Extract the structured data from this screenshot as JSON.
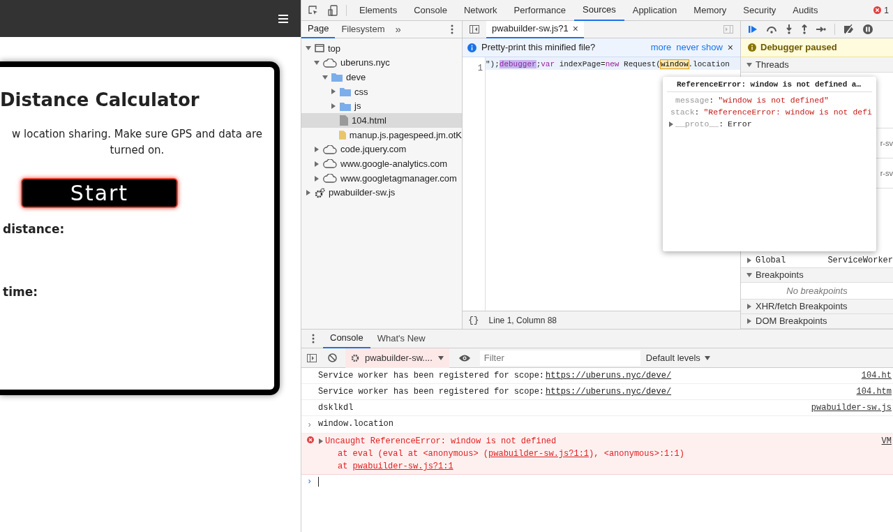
{
  "page": {
    "title": "Distance Calculator",
    "message": "w location sharing. Make sure GPS and data are turned on.",
    "start_button": "Start",
    "labels": [
      "distance:",
      "time:"
    ]
  },
  "devtools": {
    "tabs": [
      {
        "label": "Elements",
        "selected": false
      },
      {
        "label": "Console",
        "selected": false
      },
      {
        "label": "Network",
        "selected": false
      },
      {
        "label": "Performance",
        "selected": false
      },
      {
        "label": "Sources",
        "selected": true
      },
      {
        "label": "Application",
        "selected": false
      },
      {
        "label": "Memory",
        "selected": false
      },
      {
        "label": "Security",
        "selected": false
      },
      {
        "label": "Audits",
        "selected": false
      }
    ],
    "error_count": "1",
    "navigator": {
      "tabs": [
        {
          "label": "Page",
          "selected": true
        },
        {
          "label": "Filesystem",
          "selected": false
        }
      ],
      "more": "»",
      "tree": [
        {
          "label": "top",
          "kind": "frame",
          "expanded": true,
          "selected": false,
          "children": [
            {
              "label": "uberuns.nyc",
              "kind": "domain",
              "expanded": true,
              "selected": false,
              "children": [
                {
                  "label": "deve",
                  "kind": "folder",
                  "expanded": true,
                  "selected": false,
                  "children": [
                    {
                      "label": "css",
                      "kind": "folder",
                      "expanded": false,
                      "selected": false
                    },
                    {
                      "label": "js",
                      "kind": "folder",
                      "expanded": false,
                      "selected": false
                    },
                    {
                      "label": "104.html",
                      "kind": "file",
                      "selected": true
                    },
                    {
                      "label": "manup.js.pagespeed.jm.otK",
                      "kind": "script",
                      "selected": false
                    }
                  ]
                }
              ]
            },
            {
              "label": "code.jquery.com",
              "kind": "domain",
              "expanded": false,
              "selected": false
            },
            {
              "label": "www.google-analytics.com",
              "kind": "domain",
              "expanded": false,
              "selected": false
            },
            {
              "label": "www.googletagmanager.com",
              "kind": "domain",
              "expanded": false,
              "selected": false
            }
          ]
        },
        {
          "label": "pwabuilder-sw.js",
          "kind": "worker",
          "expanded": false,
          "selected": false
        }
      ]
    },
    "editor": {
      "tab": "pwabuilder-sw.js?1",
      "tab_close": "×",
      "infobar": {
        "text": "Pretty-print this minified file?",
        "links": [
          "more",
          "never show"
        ],
        "close": "×"
      },
      "line_number": "1",
      "code": [
        {
          "text": "\");",
          "kind": "plain"
        },
        {
          "text": "debugger",
          "kind": "paused"
        },
        {
          "text": ";",
          "kind": "plain"
        },
        {
          "text": "var",
          "kind": "keyword"
        },
        {
          "text": " indexPage=",
          "kind": "plain"
        },
        {
          "text": "new",
          "kind": "keyword"
        },
        {
          "text": " Request(",
          "kind": "plain"
        },
        {
          "text": "window",
          "kind": "hovered"
        },
        {
          "text": ".location",
          "kind": "plain"
        }
      ],
      "status": {
        "format": "{}",
        "position": "Line 1, Column 88"
      }
    },
    "popover": {
      "separator": ":",
      "title": "ReferenceError: window is not defined a…",
      "props": [
        {
          "key": "message",
          "value": "\"window is not defined\"",
          "expandable": false
        },
        {
          "key": "stack",
          "value": "\"ReferenceError: window is not defi",
          "expandable": false
        },
        {
          "key": "__proto__",
          "value": "Error",
          "expandable": true
        }
      ]
    },
    "sidebar": {
      "paused": "Debugger paused",
      "threads": {
        "label": "Threads",
        "expanded": true,
        "rows": [
          "r-sv",
          "r-sv"
        ]
      },
      "global": {
        "key": "Global",
        "value": "ServiceWorker"
      },
      "sections": [
        {
          "label": "Breakpoints",
          "expanded": true,
          "empty": "No breakpoints"
        },
        {
          "label": "XHR/fetch Breakpoints",
          "expanded": false
        },
        {
          "label": "DOM Breakpoints",
          "expanded": false
        }
      ]
    },
    "drawer": {
      "tabs": [
        {
          "label": "Console",
          "selected": true
        },
        {
          "label": "What's New",
          "selected": false
        }
      ],
      "context": "pwabuilder-sw....",
      "filter": {
        "placeholder": "Filter"
      },
      "levels": "Default levels",
      "messages": [
        {
          "kind": "log",
          "text": "Service worker has been registered for scope:",
          "link": "https://uberuns.nyc/deve/",
          "source": "104.ht"
        },
        {
          "kind": "log",
          "text": "Service worker has been registered for scope:",
          "link": "https://uberuns.nyc/deve/",
          "source": "104.htm"
        },
        {
          "kind": "log",
          "text": "dsklkdl",
          "source": "pwabuilder-sw.js"
        },
        {
          "kind": "input",
          "prompt": "›",
          "text": "window.location"
        },
        {
          "kind": "error",
          "text": "Uncaught ReferenceError: window is not defined",
          "source": "VM",
          "stack": [
            {
              "pre": "at eval (eval at <anonymous> (",
              "link": "pwabuilder-sw.js?1:1",
              "post": "), <anonymous>:1:1)"
            },
            {
              "pre": "at ",
              "link": "pwabuilder-sw.js?1:1"
            }
          ]
        }
      ],
      "prompt": "›"
    }
  }
}
